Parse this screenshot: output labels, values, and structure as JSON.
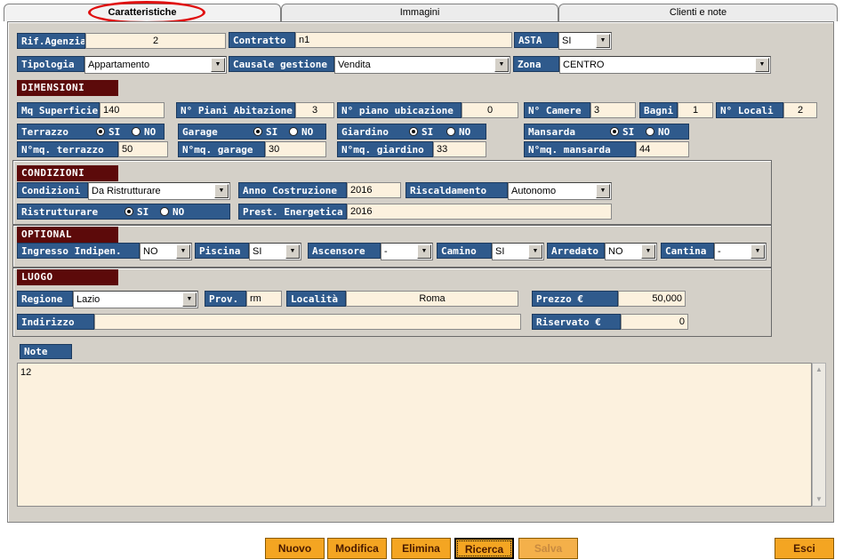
{
  "tabs": {
    "caratteristiche": "Caratteristiche",
    "immagini": "Immagini",
    "clienti": "Clienti e note"
  },
  "labels": {
    "rif": "Rif.Agenzia",
    "contratto": "Contratto",
    "asta": "ASTA",
    "tipologia": "Tipologia",
    "causale": "Causale gestione",
    "zona": "Zona",
    "dimensioni": "DIMENSIONI",
    "mq": "Mq Superficie",
    "piani": "N° Piani Abitazione",
    "ubicazione": "N° piano ubicazione",
    "camere": "N° Camere",
    "bagni": "Bagni",
    "locali": "N° Locali",
    "terrazzo": "Terrazzo",
    "garage": "Garage",
    "giardino": "Giardino",
    "mansarda": "Mansarda",
    "mqterrazzo": "N°mq. terrazzo",
    "mqgarage": "N°mq. garage",
    "mqgiardino": "N°mq. giardino",
    "mqmansarda": "N°mq. mansarda",
    "condizioni_sec": "CONDIZIONI",
    "condizioni": "Condizioni",
    "anno": "Anno Costruzione",
    "riscaldamento": "Riscaldamento",
    "ristrutturare": "Ristrutturare",
    "prest": "Prest. Energetica",
    "optional": "OPTIONAL",
    "ingresso": "Ingresso Indipen.",
    "piscina": "Piscina",
    "ascensore": "Ascensore",
    "camino": "Camino",
    "arredato": "Arredato",
    "cantina": "Cantina",
    "luogo": "LUOGO",
    "regione": "Regione",
    "prov": "Prov.",
    "localita": "Località",
    "prezzo": "Prezzo €",
    "indirizzo": "Indirizzo",
    "riservato": "Riservato €",
    "note": "Note"
  },
  "radio": {
    "si": "SI",
    "no": "NO"
  },
  "values": {
    "rif": "2",
    "contratto": "n1",
    "asta": "SI",
    "tipologia": "Appartamento",
    "causale": "Vendita",
    "zona": "CENTRO",
    "mq": "140",
    "piani": "3",
    "ubicazione": "0",
    "camere": "3",
    "bagni": "1",
    "locali": "2",
    "mqterrazzo": "50",
    "mqgarage": "30",
    "mqgiardino": "33",
    "mqmansarda": "44",
    "condizioni": "Da Ristrutturare",
    "anno": "2016",
    "riscaldamento": "Autonomo",
    "prest": "2016",
    "ingresso": "NO",
    "piscina": "SI",
    "ascensore": "-",
    "camino": "SI",
    "arredato": "NO",
    "cantina": "-",
    "regione": "Lazio",
    "prov": "rm",
    "localita": "Roma",
    "prezzo": "50,000",
    "indirizzo": "",
    "riservato": "0",
    "note": "12"
  },
  "buttons": {
    "nuovo": "Nuovo",
    "modifica": "Modifica",
    "elimina": "Elimina",
    "ricerca": "Ricerca",
    "salva": "Salva",
    "esci": "Esci"
  }
}
